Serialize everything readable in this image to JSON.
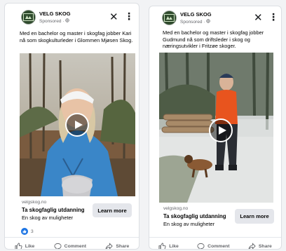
{
  "ads": [
    {
      "brand": "VELG SKOG",
      "sponsored": "Sponsored · ",
      "caption": "Med en bachelor og master i skogfag jobber Kari nå som skogkulturleder i Glommen Mjøsen Skog.",
      "domain": "velgskog.no",
      "headline": "Ta skogfaglig utdanning",
      "description": "En skog av muligheter",
      "cta": "Learn more",
      "reaction_count": "3",
      "actions": {
        "like": "Like",
        "comment": "Comment",
        "share": "Share"
      }
    },
    {
      "brand": "VELG SKOG",
      "sponsored": "Sponsored · ",
      "caption": "Med en bachelor og master i skogfag jobber Gudmund nå som driftsleder i skog og næringsutvikler i Fritzøe skoger.",
      "domain": "velgskog.no",
      "headline": "Ta skogfaglig utdanning",
      "description": "En skog av muligheter",
      "cta": "Learn more",
      "actions": {
        "like": "Like",
        "comment": "Comment",
        "share": "Share"
      }
    }
  ],
  "icons": {
    "close": "close-icon",
    "more": "more-options-icon",
    "play": "play-icon",
    "globe": "globe-icon",
    "like": "thumbs-up-icon",
    "comment": "comment-icon",
    "share": "share-icon"
  },
  "colors": {
    "brand_green": "#2e4a2c",
    "like_blue": "#1b74e4",
    "cta_bg": "#e4e6eb"
  }
}
